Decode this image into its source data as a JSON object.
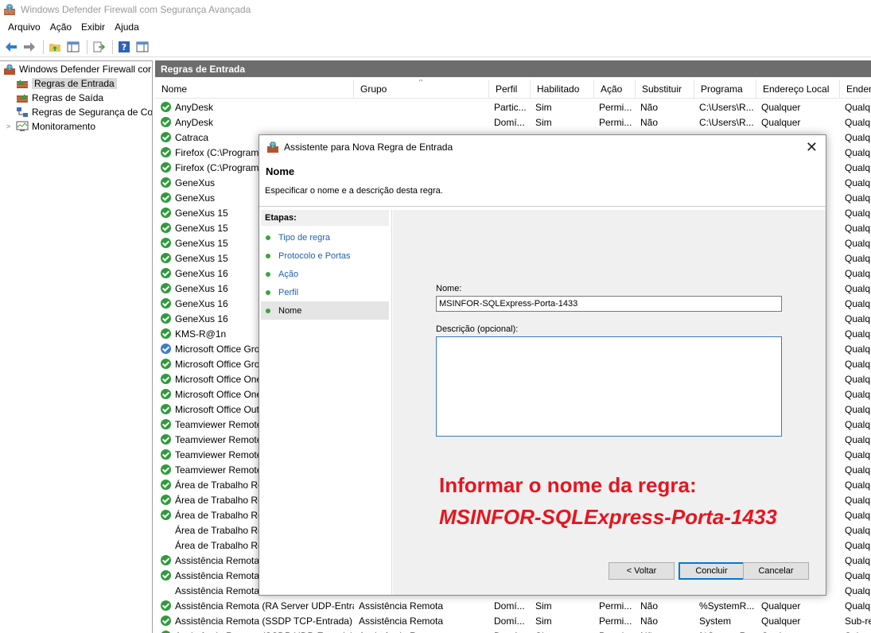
{
  "window": {
    "title": "Windows Defender Firewall com Segurança Avançada"
  },
  "menu": [
    "Arquivo",
    "Ação",
    "Exibir",
    "Ajuda"
  ],
  "tree": [
    {
      "label": "Windows Defender Firewall cor",
      "level": 0,
      "expander": ""
    },
    {
      "label": "Regras de Entrada",
      "level": 1,
      "selected": true
    },
    {
      "label": "Regras de Saída",
      "level": 1
    },
    {
      "label": "Regras de Segurança de Co",
      "level": 1
    },
    {
      "label": "Monitoramento",
      "level": 1,
      "expander": ">"
    }
  ],
  "pane": {
    "title": "Regras de Entrada"
  },
  "columns": [
    "Nome",
    "Grupo",
    "Perfil",
    "Habilitado",
    "Ação",
    "Substituir",
    "Programa",
    "Endereço Local",
    "Ender"
  ],
  "rows": [
    {
      "icon": "green",
      "cells": [
        "AnyDesk",
        "",
        "Partic...",
        "Sim",
        "Permi...",
        "Não",
        "C:\\Users\\R...",
        "Qualquer",
        "Qualq"
      ]
    },
    {
      "icon": "green",
      "cells": [
        "AnyDesk",
        "",
        "Domí...",
        "Sim",
        "Permi...",
        "Não",
        "C:\\Users\\R...",
        "Qualquer",
        "Qualq"
      ]
    },
    {
      "icon": "green",
      "cells": [
        "Catraca",
        "",
        "",
        "",
        "",
        "",
        "",
        "",
        "Qualq"
      ]
    },
    {
      "icon": "green",
      "cells": [
        "Firefox (C:\\Program",
        "",
        "",
        "",
        "",
        "",
        "",
        "",
        "Qualq"
      ]
    },
    {
      "icon": "green",
      "cells": [
        "Firefox (C:\\Program",
        "",
        "",
        "",
        "",
        "",
        "",
        "",
        "Qualq"
      ]
    },
    {
      "icon": "green",
      "cells": [
        "GeneXus",
        "",
        "",
        "",
        "",
        "",
        "",
        "",
        "Qualq"
      ]
    },
    {
      "icon": "green",
      "cells": [
        "GeneXus",
        "",
        "",
        "",
        "",
        "",
        "",
        "",
        "Qualq"
      ]
    },
    {
      "icon": "green",
      "cells": [
        "GeneXus 15",
        "",
        "",
        "",
        "",
        "",
        "",
        "",
        "Qualq"
      ]
    },
    {
      "icon": "green",
      "cells": [
        "GeneXus 15",
        "",
        "",
        "",
        "",
        "",
        "",
        "",
        "Qualq"
      ]
    },
    {
      "icon": "green",
      "cells": [
        "GeneXus 15",
        "",
        "",
        "",
        "",
        "",
        "",
        "",
        "Qualq"
      ]
    },
    {
      "icon": "green",
      "cells": [
        "GeneXus 15",
        "",
        "",
        "",
        "",
        "",
        "",
        "",
        "Qualq"
      ]
    },
    {
      "icon": "green",
      "cells": [
        "GeneXus 16",
        "",
        "",
        "",
        "",
        "",
        "",
        "",
        "Qualq"
      ]
    },
    {
      "icon": "green",
      "cells": [
        "GeneXus 16",
        "",
        "",
        "",
        "",
        "",
        "",
        "",
        "Qualq"
      ]
    },
    {
      "icon": "green",
      "cells": [
        "GeneXus 16",
        "",
        "",
        "",
        "",
        "",
        "",
        "",
        "Qualq"
      ]
    },
    {
      "icon": "green",
      "cells": [
        "GeneXus 16",
        "",
        "",
        "",
        "",
        "",
        "",
        "",
        "Qualq"
      ]
    },
    {
      "icon": "green",
      "cells": [
        "KMS-R@1n",
        "",
        "",
        "",
        "",
        "",
        "",
        "",
        "Qualq"
      ]
    },
    {
      "icon": "blue",
      "cells": [
        "Microsoft Office Gro",
        "",
        "",
        "",
        "",
        "",
        "",
        "",
        "Qualq"
      ]
    },
    {
      "icon": "green",
      "cells": [
        "Microsoft Office Gro",
        "",
        "",
        "",
        "",
        "",
        "",
        "",
        "Qualq"
      ]
    },
    {
      "icon": "green",
      "cells": [
        "Microsoft Office One",
        "",
        "",
        "",
        "",
        "",
        "",
        "",
        "Qualq"
      ]
    },
    {
      "icon": "green",
      "cells": [
        "Microsoft Office One",
        "",
        "",
        "",
        "",
        "",
        "",
        "",
        "Qualq"
      ]
    },
    {
      "icon": "green",
      "cells": [
        "Microsoft Office Out",
        "",
        "",
        "",
        "",
        "",
        "",
        "",
        "Qualq"
      ]
    },
    {
      "icon": "green",
      "cells": [
        "Teamviewer Remote",
        "",
        "",
        "",
        "",
        "",
        "",
        "",
        "Qualq"
      ]
    },
    {
      "icon": "green",
      "cells": [
        "Teamviewer Remote",
        "",
        "",
        "",
        "",
        "",
        "",
        "",
        "Qualq"
      ]
    },
    {
      "icon": "green",
      "cells": [
        "Teamviewer Remote",
        "",
        "",
        "",
        "",
        "",
        "",
        "",
        "Qualq"
      ]
    },
    {
      "icon": "green",
      "cells": [
        "Teamviewer Remote",
        "",
        "",
        "",
        "",
        "",
        "",
        "",
        "Qualq"
      ]
    },
    {
      "icon": "green",
      "cells": [
        "Área de Trabalho Re",
        "",
        "",
        "",
        "",
        "",
        "",
        "",
        "Qualq"
      ]
    },
    {
      "icon": "green",
      "cells": [
        "Área de Trabalho Re",
        "",
        "",
        "",
        "",
        "",
        "",
        "",
        "Qualq"
      ]
    },
    {
      "icon": "green",
      "cells": [
        "Área de Trabalho Re",
        "",
        "",
        "",
        "",
        "",
        "",
        "",
        "Qualq"
      ]
    },
    {
      "icon": "none",
      "cells": [
        "Área de Trabalho Re",
        "",
        "",
        "",
        "",
        "",
        "",
        "",
        "Qualq"
      ]
    },
    {
      "icon": "none",
      "cells": [
        "Área de Trabalho Re",
        "",
        "",
        "",
        "",
        "",
        "",
        "",
        "Qualq"
      ]
    },
    {
      "icon": "green",
      "cells": [
        "Assistência Remota (",
        "",
        "",
        "",
        "",
        "",
        "",
        "",
        "Qualq"
      ]
    },
    {
      "icon": "green",
      "cells": [
        "Assistência Remota (",
        "",
        "",
        "",
        "",
        "",
        "",
        "",
        "Qualq"
      ]
    },
    {
      "icon": "none",
      "cells": [
        "Assistência Remota",
        "",
        "",
        "",
        "",
        "",
        "",
        "",
        "Qualq"
      ]
    },
    {
      "icon": "green",
      "cells": [
        "Assistência Remota (RA Server UDP-Entra...",
        "Assistência Remota",
        "Domí...",
        "Sim",
        "Permi...",
        "Não",
        "%SystemR...",
        "Qualquer",
        "Qualq"
      ]
    },
    {
      "icon": "green",
      "cells": [
        "Assistência Remota (SSDP TCP-Entrada)",
        "Assistência Remota",
        "Domí...",
        "Sim",
        "Permi...",
        "Não",
        "System",
        "Qualquer",
        "Sub-re"
      ]
    },
    {
      "icon": "green",
      "cells": [
        "Assistência Remota (SSDP UDP-Entrada)",
        "Assistência Remota",
        "Domí...",
        "Sim",
        "Permi...",
        "Não",
        "%SystemR...",
        "Qualquer",
        "Sub-re"
      ]
    }
  ],
  "dialog": {
    "title": "Assistente para Nova Regra de Entrada",
    "heading": "Nome",
    "subtitle": "Especificar o nome e a descrição desta regra.",
    "steps_title": "Etapas:",
    "steps": [
      {
        "label": "Tipo de regra",
        "current": false
      },
      {
        "label": "Protocolo e Portas",
        "current": false
      },
      {
        "label": "Ação",
        "current": false
      },
      {
        "label": "Perfil",
        "current": false
      },
      {
        "label": "Nome",
        "current": true
      }
    ],
    "name_label": "Nome:",
    "name_value": "MSINFOR-SQLExpress-Porta-1433",
    "desc_label": "Descrição (opcional):",
    "desc_value": "",
    "annotation_line1": "Informar o nome da regra:",
    "annotation_line2": "MSINFOR-SQLExpress-Porta-1433",
    "buttons": {
      "back": "< Voltar",
      "finish": "Concluir",
      "cancel": "Cancelar"
    }
  },
  "colors": {
    "accent": "#0078d7",
    "annotation": "#e8141e",
    "rule_enabled": "#2f9b3c",
    "pane_header": "#6d6d6d"
  }
}
